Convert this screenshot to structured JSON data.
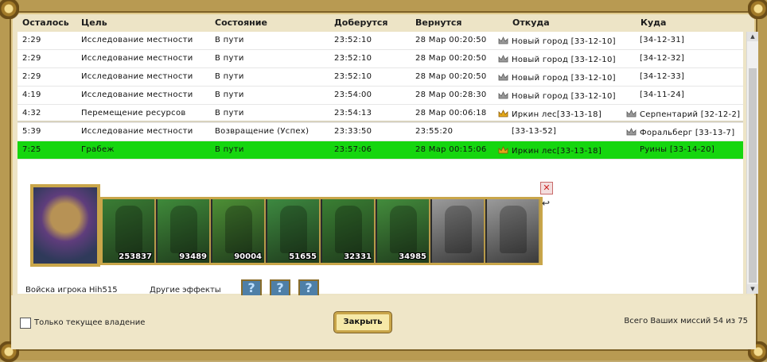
{
  "columns": {
    "remaining": "Осталось",
    "target": "Цель",
    "state": "Состояние",
    "arrive": "Доберутся",
    "return": "Вернутся",
    "from": "Откуда",
    "to": "Куда"
  },
  "missions": [
    {
      "remaining": "2:29",
      "target": "Исследование местности",
      "state": "В пути",
      "arrive": "23:52:10",
      "return": "28 Мар 00:20:50",
      "from_icon": "silver-crown",
      "from": "Новый город [33-12-10]",
      "to_icon": "",
      "to": "[34-12-31]"
    },
    {
      "remaining": "2:29",
      "target": "Исследование местности",
      "state": "В пути",
      "arrive": "23:52:10",
      "return": "28 Мар 00:20:50",
      "from_icon": "silver-crown",
      "from": "Новый город [33-12-10]",
      "to_icon": "",
      "to": "[34-12-32]"
    },
    {
      "remaining": "2:29",
      "target": "Исследование местности",
      "state": "В пути",
      "arrive": "23:52:10",
      "return": "28 Мар 00:20:50",
      "from_icon": "silver-crown",
      "from": "Новый город [33-12-10]",
      "to_icon": "",
      "to": "[34-12-33]"
    },
    {
      "remaining": "4:19",
      "target": "Исследование местности",
      "state": "В пути",
      "arrive": "23:54:00",
      "return": "28 Мар 00:28:30",
      "from_icon": "silver-crown",
      "from": "Новый город [33-12-10]",
      "to_icon": "",
      "to": "[34-11-24]"
    },
    {
      "remaining": "4:32",
      "target": "Перемещение ресурсов",
      "state": "В пути",
      "arrive": "23:54:13",
      "return": "28 Мар 00:06:18",
      "from_icon": "gold-crown",
      "from": "Иркин лес[33-13-18]",
      "to_icon": "silver-crown",
      "to": "Серпентарий [32-12-2]"
    },
    {
      "remaining": "5:39",
      "target": "Исследование местности",
      "state": "Возвращение (Успех)",
      "arrive": "23:33:50",
      "return": "23:55:20",
      "from_icon": "",
      "from": "[33-13-52]",
      "to_icon": "silver-crown",
      "to": "Форальберг [33-13-7]"
    },
    {
      "remaining": "7:25",
      "target": "Грабеж",
      "state": "В пути",
      "arrive": "23:57:06",
      "return": "28 Мар 00:15:06",
      "from_icon": "gold-crown",
      "from": "Иркин лес[33-13-18]",
      "to_icon": "",
      "to": "Руины [33-14-20]",
      "selected": true
    }
  ],
  "army": {
    "units": [
      {
        "name": "unit-1",
        "count": "253837",
        "color": "#3a7d34"
      },
      {
        "name": "unit-2",
        "count": "93489",
        "color": "#3f8a3a"
      },
      {
        "name": "unit-3",
        "count": "90004",
        "color": "#4d8f35"
      },
      {
        "name": "unit-4",
        "count": "51655",
        "color": "#3d8940"
      },
      {
        "name": "unit-5",
        "count": "32331",
        "color": "#3a7f33"
      },
      {
        "name": "unit-6",
        "count": "34985",
        "color": "#438c3c"
      },
      {
        "name": "unit-7",
        "count": "",
        "color": "#7a7a7a"
      },
      {
        "name": "unit-8",
        "count": "",
        "color": "#8a8a8a"
      }
    ],
    "player_label": "Войска игрока Hih515",
    "effects_label": "Другие эффекты",
    "effects": [
      "?",
      "?",
      "?"
    ]
  },
  "footer": {
    "checkbox_label": "Только текущее владение",
    "close_label": "Закрыть",
    "total_label": "Всего Ваших миссий 54 из 75"
  },
  "colors": {
    "selected_row": "#15d60f",
    "frame_gold": "#c9a64a",
    "panel_bg": "#ede4c6"
  }
}
